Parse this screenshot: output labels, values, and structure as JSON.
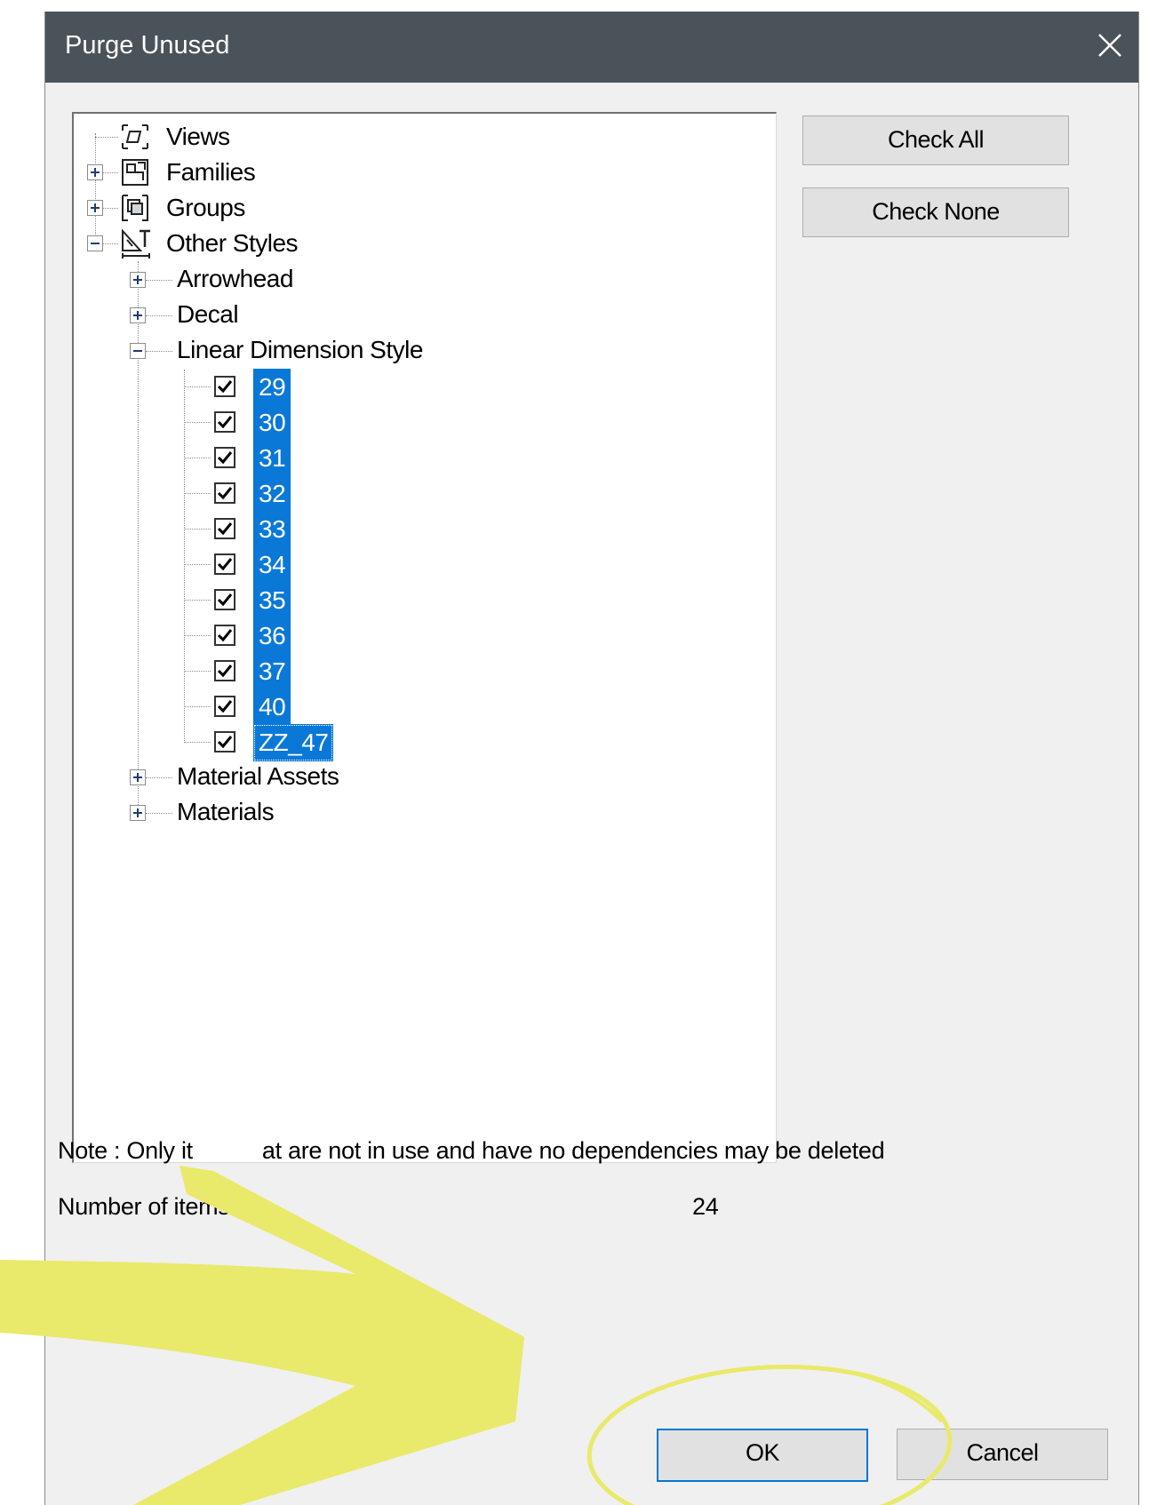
{
  "window": {
    "title": "Purge Unused"
  },
  "tree": {
    "top_nodes": [
      {
        "label": "Views",
        "icon": "views-icon",
        "expander": "none"
      },
      {
        "label": "Families",
        "icon": "families-icon",
        "expander": "plus"
      },
      {
        "label": "Groups",
        "icon": "groups-icon",
        "expander": "plus"
      },
      {
        "label": "Other Styles",
        "icon": "other-styles-icon",
        "expander": "minus"
      }
    ],
    "other_styles_children": [
      {
        "label": "Arrowhead",
        "expander": "plus"
      },
      {
        "label": "Decal",
        "expander": "plus"
      },
      {
        "label": "Linear Dimension Style",
        "expander": "minus"
      },
      {
        "label": "Material Assets",
        "expander": "plus"
      },
      {
        "label": "Materials",
        "expander": "plus"
      }
    ],
    "linear_dimension_items": [
      {
        "label": "29",
        "checked": true
      },
      {
        "label": "30",
        "checked": true
      },
      {
        "label": "31",
        "checked": true
      },
      {
        "label": "32",
        "checked": true
      },
      {
        "label": "33",
        "checked": true
      },
      {
        "label": "34",
        "checked": true
      },
      {
        "label": "35",
        "checked": true
      },
      {
        "label": "36",
        "checked": true
      },
      {
        "label": "37",
        "checked": true
      },
      {
        "label": "40",
        "checked": true
      },
      {
        "label": "ZZ_47",
        "checked": true
      }
    ]
  },
  "buttons": {
    "check_all": "Check All",
    "check_none": "Check None",
    "ok": "OK",
    "cancel": "Cancel"
  },
  "footer": {
    "note_start": "Note : Only it",
    "note_end": "at are not in use and have no dependencies may be deleted",
    "count_label": "Number of items ch",
    "count_value": "24"
  },
  "colors": {
    "titlebar": "#4b535a",
    "selection": "#0a78d7",
    "annotation_yellow": "#e9e96b",
    "default_button_border": "#0078d7"
  }
}
